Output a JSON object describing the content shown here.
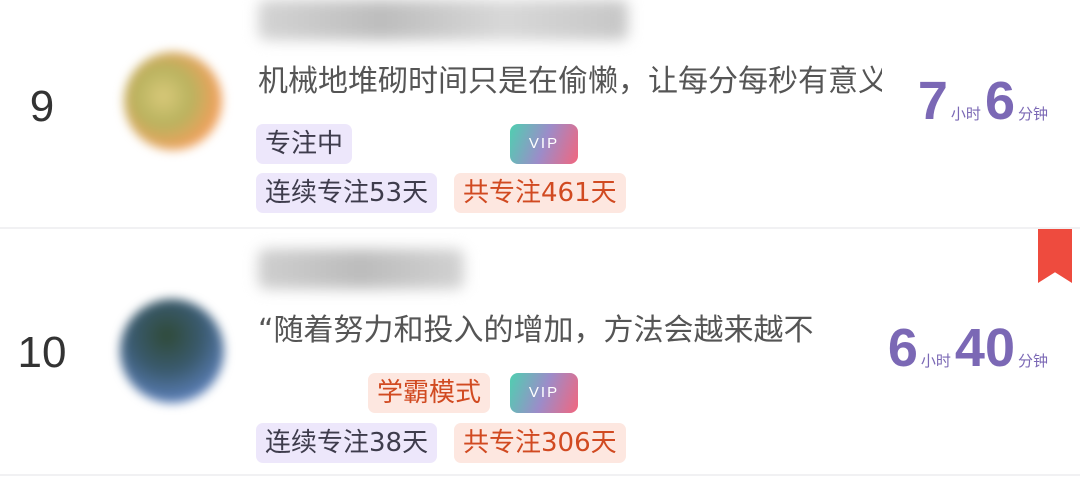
{
  "rows": [
    {
      "rank": "9",
      "motto": "机械地堆砌时间只是在偷懒，让每分每秒有意义",
      "status": "专注中",
      "vip": "VIP",
      "streak": "连续专注53天",
      "total": "共专注461天",
      "hours": "7",
      "hour_unit": "小时",
      "minutes": "6",
      "minute_unit": "分钟"
    },
    {
      "rank": "10",
      "motto": "“随着努力和投入的增加，方法会越来越不",
      "mode": "学霸模式",
      "vip": "VIP",
      "streak": "连续专注38天",
      "total": "共专注306天",
      "hours": "6",
      "hour_unit": "小时",
      "minutes": "40",
      "minute_unit": "分钟"
    }
  ],
  "colors": {
    "accent": "#7b68b5",
    "orange_text": "#d14a21",
    "bookmark": "#ee4b3e"
  },
  "icons": {
    "bookmark": "bookmark-icon"
  }
}
